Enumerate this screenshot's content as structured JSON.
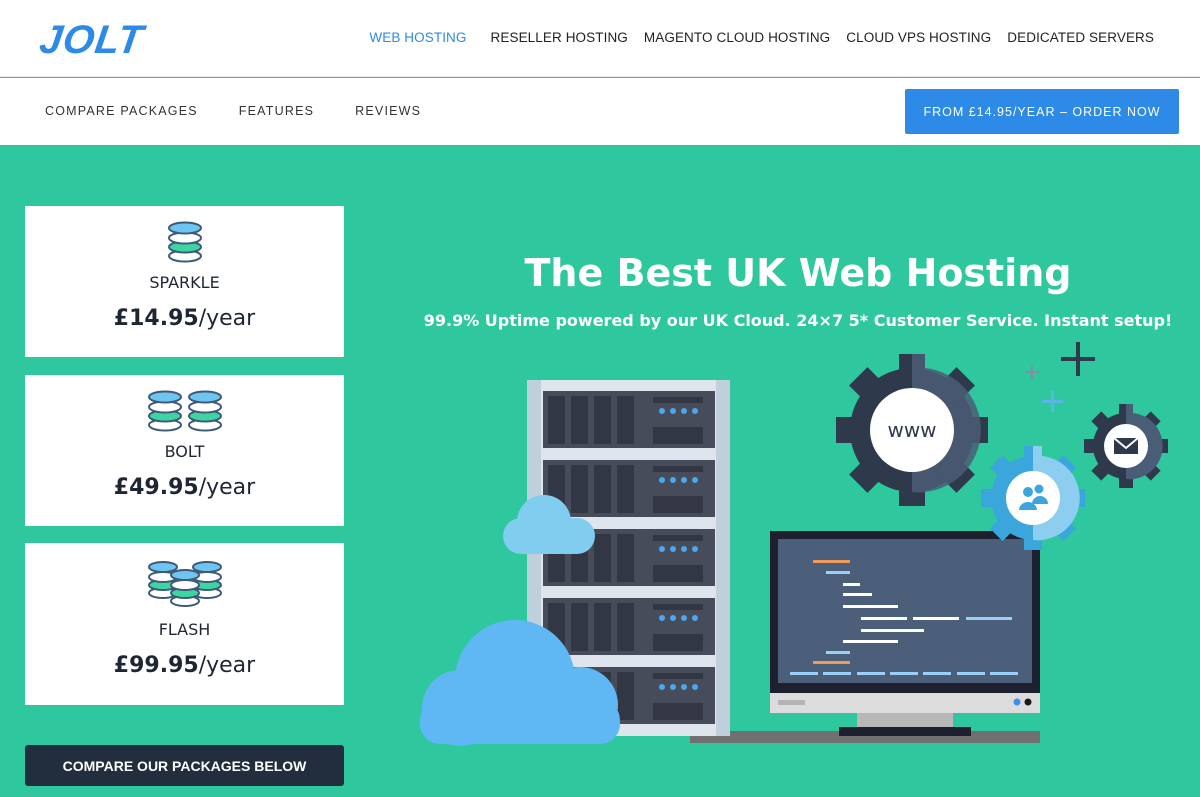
{
  "brand": {
    "logo_text": "JOLT",
    "accent": "#2d8ae6",
    "hero_bg": "#2fc89e",
    "dark": "#222d3d"
  },
  "main_nav": [
    {
      "label": "WEB HOSTING",
      "active": true
    },
    {
      "label": "RESELLER HOSTING",
      "active": false
    },
    {
      "label": "MAGENTO CLOUD HOSTING",
      "active": false
    },
    {
      "label": "CLOUD VPS HOSTING",
      "active": false
    },
    {
      "label": "DEDICATED SERVERS",
      "active": false
    }
  ],
  "sub_nav": [
    {
      "label": "COMPARE PACKAGES"
    },
    {
      "label": "FEATURES"
    },
    {
      "label": "REVIEWS"
    }
  ],
  "order_button": {
    "label": "FROM £14.95/YEAR – ORDER NOW"
  },
  "packages": [
    {
      "name": "SPARKLE",
      "price_amount": "£14.95",
      "price_period": "/year",
      "icon": "database-single-icon"
    },
    {
      "name": "BOLT",
      "price_amount": "£49.95",
      "price_period": "/year",
      "icon": "database-double-icon"
    },
    {
      "name": "FLASH",
      "price_amount": "£99.95",
      "price_period": "/year",
      "icon": "database-triple-icon"
    }
  ],
  "compare_button": {
    "label": "COMPARE OUR PACKAGES BELOW"
  },
  "hero": {
    "title": "The Best UK Web Hosting",
    "subtitle": "99.9% Uptime powered by our UK Cloud. 24×7 5* Customer Service. Instant setup!",
    "gear_www_label": "www"
  }
}
